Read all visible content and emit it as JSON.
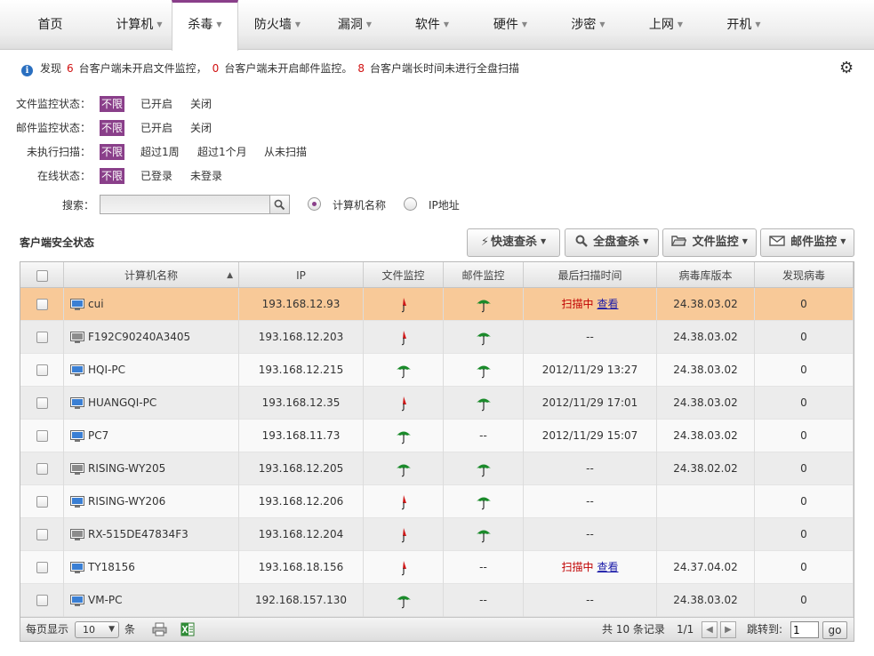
{
  "nav": {
    "items": [
      {
        "label": "首页",
        "caret": false
      },
      {
        "label": "计算机",
        "caret": true
      },
      {
        "label": "杀毒",
        "caret": true
      },
      {
        "label": "防火墙",
        "caret": true
      },
      {
        "label": "漏洞",
        "caret": true
      },
      {
        "label": "软件",
        "caret": true
      },
      {
        "label": "硬件",
        "caret": true
      },
      {
        "label": "涉密",
        "caret": true
      },
      {
        "label": "上网",
        "caret": true
      },
      {
        "label": "开机",
        "caret": true
      }
    ],
    "active_index": 2,
    "accent_color": "#8a3f8a"
  },
  "notice": {
    "icon": "info-icon",
    "prefix": "发现",
    "count1": "6",
    "text1": "台客户端未开启文件监控，",
    "count2": "0",
    "text2": "台客户端未开启邮件监控。",
    "count3": "8",
    "text3": "台客户端长时间未进行全盘扫描",
    "settings_icon": "gear-icon"
  },
  "filters": {
    "file_monitor": {
      "label": "文件监控状态：",
      "options": [
        "不限",
        "已开启",
        "关闭"
      ],
      "selected": 0
    },
    "mail_monitor": {
      "label": "邮件监控状态：",
      "options": [
        "不限",
        "已开启",
        "关闭"
      ],
      "selected": 0
    },
    "unscanned": {
      "label": "未执行扫描：",
      "options": [
        "不限",
        "超过1周",
        "超过1个月",
        "从未扫描"
      ],
      "selected": 0
    },
    "online": {
      "label": "在线状态：",
      "options": [
        "不限",
        "已登录",
        "未登录"
      ],
      "selected": 0
    }
  },
  "search": {
    "label": "搜索：",
    "value": "",
    "button_icon": "search-icon",
    "radio_name": "计算机名称",
    "radio_ip": "IP地址",
    "selected": "name"
  },
  "section": {
    "title": "客户端安全状态"
  },
  "toolbar": {
    "quick_scan": "快速查杀",
    "full_scan": "全盘查杀",
    "file_monitor": "文件监控",
    "mail_monitor": "邮件监控"
  },
  "table": {
    "columns": [
      "计算机名称",
      "IP",
      "文件监控",
      "邮件监控",
      "最后扫描时间",
      "病毒库版本",
      "发现病毒"
    ],
    "sort_column": "计算机名称",
    "sort_direction": "asc",
    "rows": [
      {
        "name": "cui",
        "pc": "blue",
        "ip": "193.168.12.93",
        "file": "off",
        "mail": "on",
        "scan": "扫描中",
        "scan_link": "查看",
        "db": "24.38.03.02",
        "virus": "0",
        "selected": true
      },
      {
        "name": "F192C90240A3405",
        "pc": "gray",
        "ip": "193.168.12.203",
        "file": "off",
        "mail": "on",
        "scan": "--",
        "scan_link": "",
        "db": "24.38.03.02",
        "virus": "0",
        "selected": false
      },
      {
        "name": "HQI-PC",
        "pc": "blue",
        "ip": "193.168.12.215",
        "file": "on",
        "mail": "on",
        "scan": "2012/11/29 13:27",
        "scan_link": "",
        "db": "24.38.03.02",
        "virus": "0",
        "selected": false
      },
      {
        "name": "HUANGQI-PC",
        "pc": "blue",
        "ip": "193.168.12.35",
        "file": "off",
        "mail": "on",
        "scan": "2012/11/29 17:01",
        "scan_link": "",
        "db": "24.38.03.02",
        "virus": "0",
        "selected": false
      },
      {
        "name": "PC7",
        "pc": "blue",
        "ip": "193.168.11.73",
        "file": "on",
        "mail": "--",
        "scan": "2012/11/29 15:07",
        "scan_link": "",
        "db": "24.38.03.02",
        "virus": "0",
        "selected": false
      },
      {
        "name": "RISING-WY205",
        "pc": "gray",
        "ip": "193.168.12.205",
        "file": "on",
        "mail": "on",
        "scan": "--",
        "scan_link": "",
        "db": "24.38.02.02",
        "virus": "0",
        "selected": false
      },
      {
        "name": "RISING-WY206",
        "pc": "blue",
        "ip": "193.168.12.206",
        "file": "off",
        "mail": "on",
        "scan": "--",
        "scan_link": "",
        "db": "",
        "virus": "0",
        "selected": false
      },
      {
        "name": "RX-515DE47834F3",
        "pc": "gray",
        "ip": "193.168.12.204",
        "file": "off",
        "mail": "on",
        "scan": "--",
        "scan_link": "",
        "db": "",
        "virus": "0",
        "selected": false
      },
      {
        "name": "TY18156",
        "pc": "blue",
        "ip": "193.168.18.156",
        "file": "off",
        "mail": "--",
        "scan": "扫描中",
        "scan_link": "查看",
        "db": "24.37.04.02",
        "virus": "0",
        "selected": false
      },
      {
        "name": "VM-PC",
        "pc": "blue",
        "ip": "192.168.157.130",
        "file": "on",
        "mail": "--",
        "scan": "--",
        "scan_link": "",
        "db": "24.38.03.02",
        "virus": "0",
        "selected": false
      }
    ]
  },
  "footer": {
    "per_page_label": "每页显示",
    "per_page_value": "10",
    "per_page_unit": "条",
    "print_icon": "printer-icon",
    "excel_icon": "excel-export-icon",
    "total_text": "共 10 条记录",
    "page_text": "1/1",
    "goto_label": "跳转到:",
    "goto_value": "1",
    "go_label": "go"
  },
  "colors": {
    "selected_row": "#f8c998",
    "umbrella_on": "#1a8a2a",
    "umbrella_off": "#d01818",
    "scanning_text": "#c00000"
  }
}
